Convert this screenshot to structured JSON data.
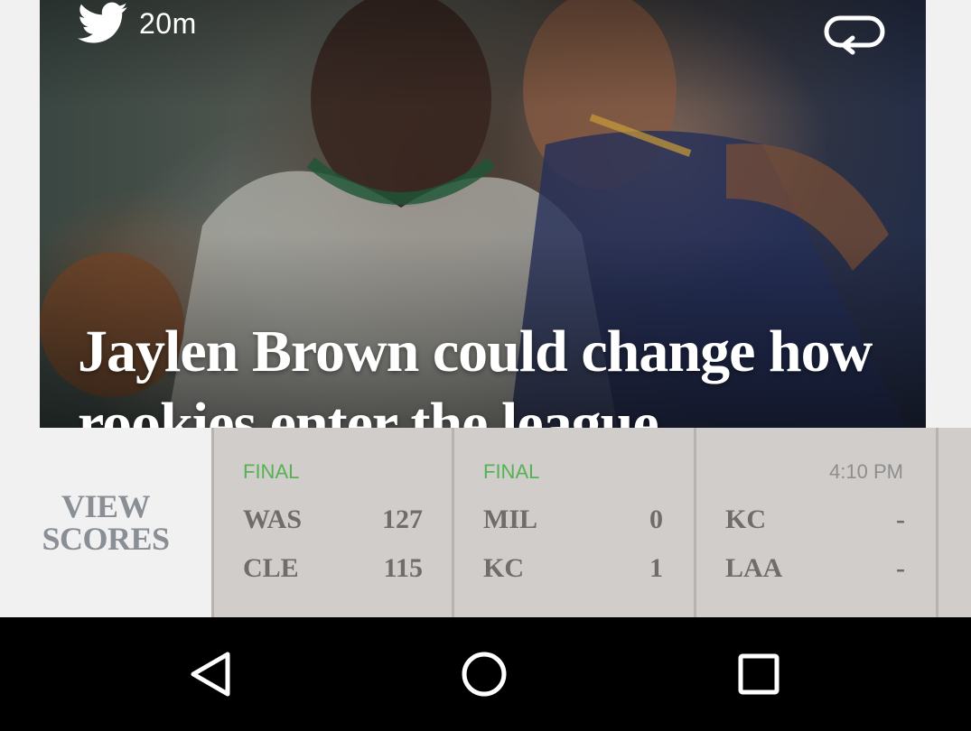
{
  "story": {
    "time_ago": "20m",
    "source_icon": "twitter-bird-icon",
    "share_icon": "share-arrow-icon",
    "headline": "Jaylen Brown could change how rookies enter the league"
  },
  "scores": {
    "view_label_line1": "VIEW",
    "view_label_line2": "SCORES",
    "colors": {
      "final": "#55b255",
      "scheduled": "#8e8e8e",
      "team_text": "#6f6d6b",
      "view_label": "#8a8f96"
    },
    "games": [
      {
        "status": "FINAL",
        "teams": [
          {
            "abbr": "WAS",
            "score": "127"
          },
          {
            "abbr": "CLE",
            "score": "115"
          }
        ]
      },
      {
        "status": "FINAL",
        "teams": [
          {
            "abbr": "MIL",
            "score": "0"
          },
          {
            "abbr": "KC",
            "score": "1"
          }
        ]
      },
      {
        "status": "4:10 PM",
        "teams": [
          {
            "abbr": "KC",
            "score": "-"
          },
          {
            "abbr": "LAA",
            "score": "-"
          }
        ]
      }
    ]
  },
  "navbar": {
    "back_icon": "back-triangle-icon",
    "home_icon": "home-circle-icon",
    "recents_icon": "recents-square-icon"
  }
}
